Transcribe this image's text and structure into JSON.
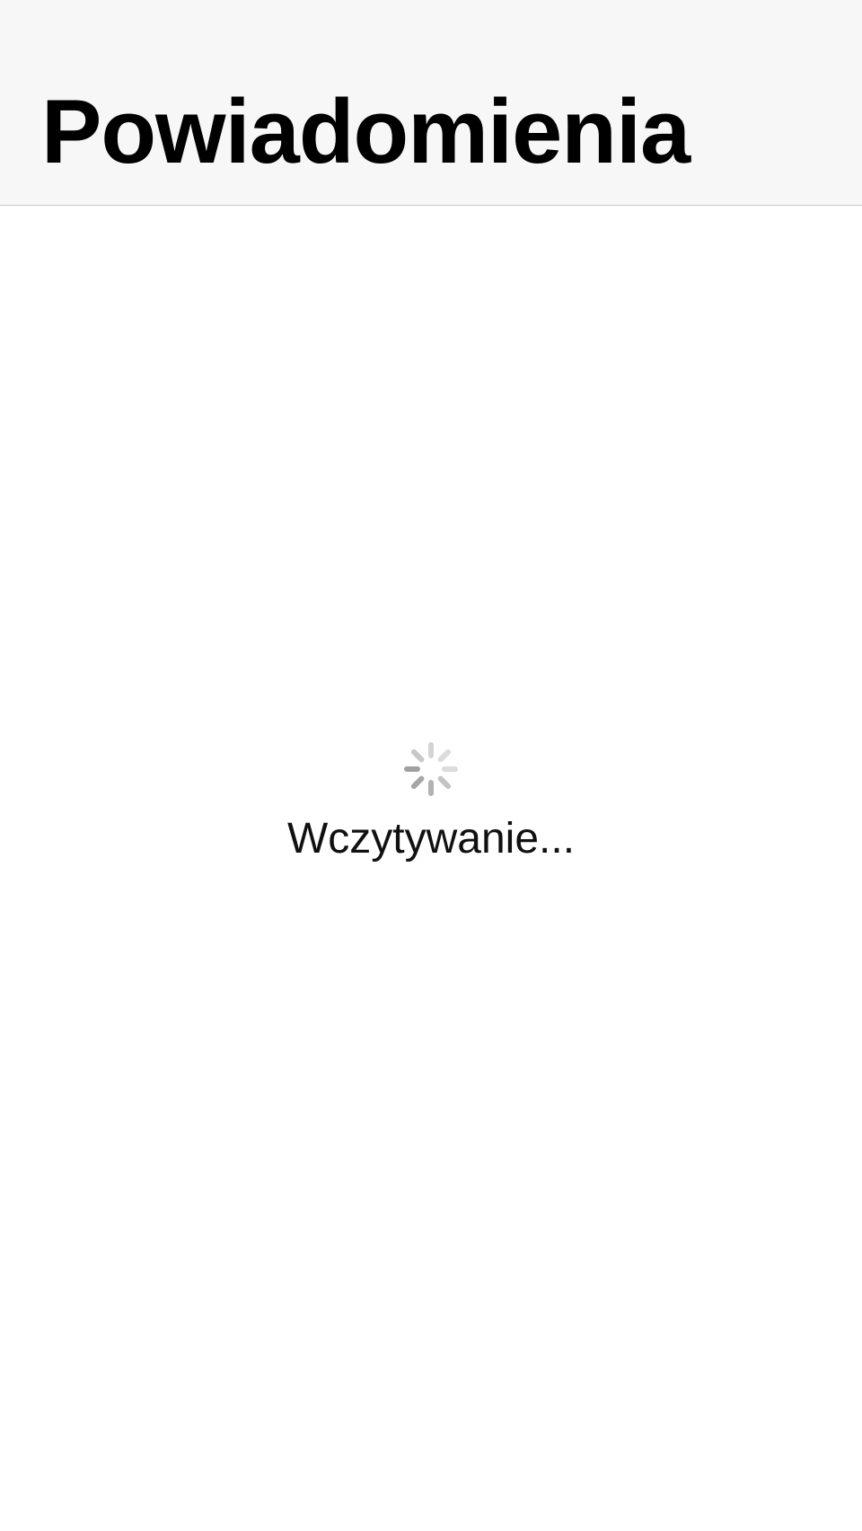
{
  "header": {
    "title": "Powiadomienia",
    "background_color": "#f7f7f7"
  },
  "loading": {
    "label": "Wczytywanie...",
    "spinner_icon": "activity-indicator-icon",
    "spinner_color": "#8e8e93"
  }
}
